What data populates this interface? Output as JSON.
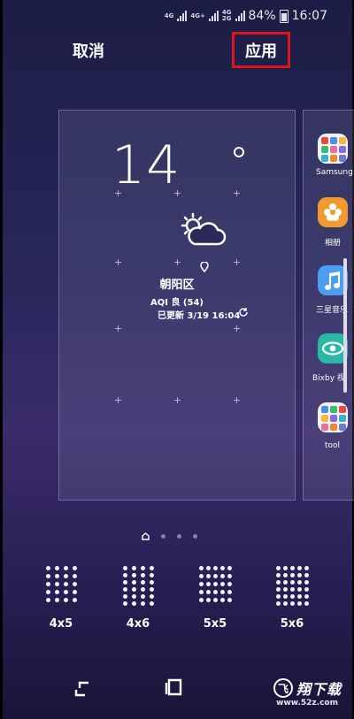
{
  "status_bar": {
    "network_1": "4G",
    "network_2": "4G+",
    "network_3": "4G",
    "network_3_sub": "2G",
    "battery": "84%",
    "time": "16:07"
  },
  "header": {
    "cancel_label": "取消",
    "apply_label": "应用"
  },
  "weather_widget": {
    "temperature": "14",
    "city": "朝阳区",
    "aqi": "AQI 良 (54)",
    "updated": "已更新 3/19 16:04",
    "condition_icon": "partly-cloudy-icon"
  },
  "next_page_apps": [
    {
      "label": "Samsung",
      "icon": "samsung-folder-icon"
    },
    {
      "label": "相册",
      "icon": "gallery-icon"
    },
    {
      "label": "三星音乐",
      "icon": "music-icon"
    },
    {
      "label": "Bixby 视",
      "icon": "bixby-vision-icon"
    },
    {
      "label": "tool",
      "icon": "tool-folder-icon"
    }
  ],
  "grid_options": [
    {
      "label": "4x5",
      "cols": 4,
      "rows": 5
    },
    {
      "label": "4x6",
      "cols": 4,
      "rows": 6
    },
    {
      "label": "5x5",
      "cols": 5,
      "rows": 5
    },
    {
      "label": "5x6",
      "cols": 5,
      "rows": 6
    }
  ],
  "page_indicator": {
    "pages": 4,
    "current": 1
  },
  "watermark": {
    "brand": "翔下载",
    "url": "www.52z.com"
  },
  "colors": {
    "highlight_border": "#e0141c",
    "bg_top": "#1c1d44",
    "bg_mid": "#3a2c6a"
  }
}
